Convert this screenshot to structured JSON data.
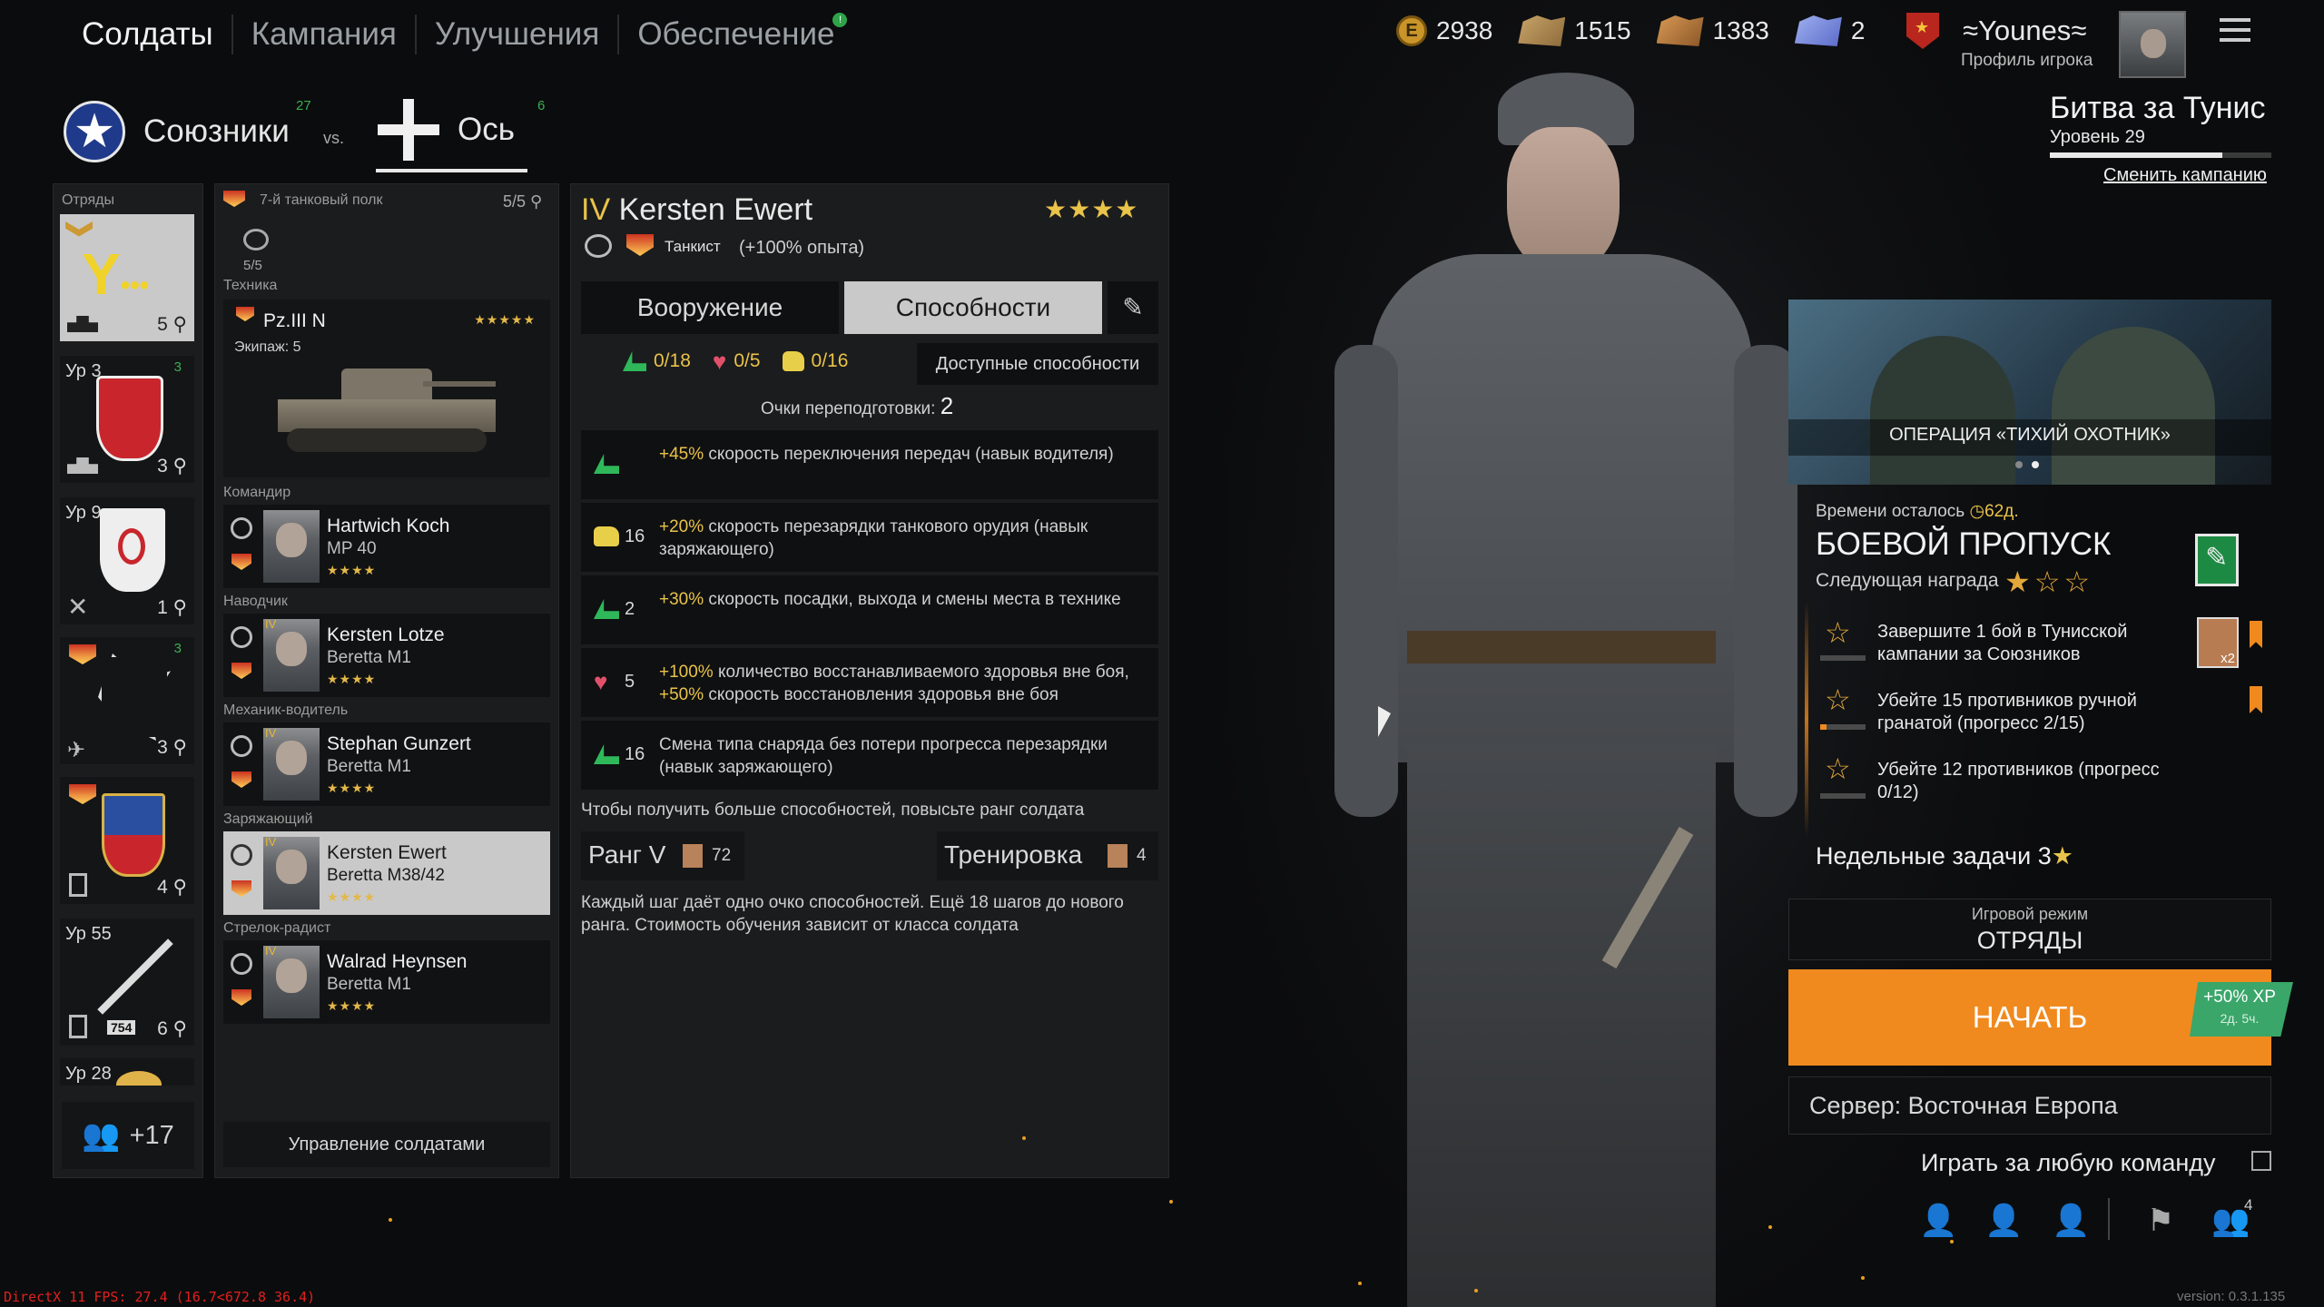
{
  "nav": {
    "tabs": [
      "Солдаты",
      "Кампания",
      "Улучшения",
      "Обеспечение"
    ],
    "supply_badge": "!"
  },
  "currency": {
    "gold": "2938",
    "orders_silver": "1515",
    "orders_bronze": "1383",
    "tickets": "2"
  },
  "profile": {
    "name": "Younes",
    "profile_label": "Профиль игрока"
  },
  "campaign": {
    "title": "Битва за Тунис",
    "level": "Уровень 29",
    "progress": 0.78,
    "change_link": "Сменить кампанию"
  },
  "factions": {
    "allies": "Союзники",
    "allies_count": "27",
    "vs": "vs.",
    "axis": "Ось",
    "axis_count": "6"
  },
  "squads": {
    "header": "Отряды",
    "items": [
      {
        "level": "",
        "count": "5"
      },
      {
        "level": "Ур 3",
        "count": "3",
        "badge": "3"
      },
      {
        "level": "Ур 9",
        "count": "1"
      },
      {
        "level": "",
        "count": "3",
        "badge": "3"
      },
      {
        "level": "",
        "count": "4"
      },
      {
        "level": "Ур 55",
        "count": "6",
        "tag": "754"
      },
      {
        "level": "Ур 28",
        "count": ""
      }
    ],
    "more": "+17"
  },
  "squad_detail": {
    "name": "7-й танковый полк",
    "capacity": "5/5",
    "vehicle_count": "5/5",
    "vehicle_section": "Техника",
    "vehicle_name": "Pz.III N",
    "vehicle_crew": "Экипаж: 5",
    "vehicle_stars": "★★★★★",
    "manage_button": "Управление солдатами",
    "soldiers": [
      {
        "role": "Командир",
        "name": "Hartwich Koch",
        "weapon": "MP 40",
        "stars": "★★★★",
        "rank": ""
      },
      {
        "role": "Наводчик",
        "name": "Kersten Lotze",
        "weapon": "Beretta M1",
        "stars": "★★★★",
        "rank": "IV"
      },
      {
        "role": "Механик-водитель",
        "name": "Stephan Gunzert",
        "weapon": "Beretta M1",
        "stars": "★★★★",
        "rank": "IV"
      },
      {
        "role": "Заряжающий",
        "name": "Kersten Ewert",
        "weapon": "Beretta M38/42",
        "stars": "★★★★",
        "rank": "IV"
      },
      {
        "role": "Стрелок-радист",
        "name": "Walrad Heynsen",
        "weapon": "Beretta M1",
        "stars": "★★★★",
        "rank": "IV"
      }
    ]
  },
  "soldier": {
    "rank": "IV",
    "name": "Kersten Ewert",
    "stars": "★★★★",
    "class": "Танкист",
    "bonus": "(+100% опыта)",
    "tab_weapons": "Вооружение",
    "tab_abilities": "Способности",
    "stat_a": "0/18",
    "stat_b": "0/5",
    "stat_c": "0/16",
    "available_button": "Доступные способности",
    "retrain_label": "Очки переподготовки:",
    "retrain_value": "2",
    "abilities": [
      {
        "num": "",
        "hl": "+45%",
        "text": " скорость переключения передач (навык водителя)",
        "hl2": "",
        "text2": ""
      },
      {
        "num": "16",
        "hl": "+20%",
        "text": " скорость перезарядки танкового орудия (навык заряжающего)",
        "hl2": "",
        "text2": ""
      },
      {
        "num": "2",
        "hl": "+30%",
        "text": " скорость посадки, выхода и смены места в технике",
        "hl2": "",
        "text2": ""
      },
      {
        "num": "5",
        "hl": "+100%",
        "text": " количество восстанавливаемого здоровья вне боя, ",
        "hl2": "+50%",
        "text2": " скорость восстановления здоровья вне боя"
      },
      {
        "num": "16",
        "hl": "",
        "text": "Смена типа снаряда без потери прогресса перезарядки (навык заряжающего)",
        "hl2": "",
        "text2": ""
      }
    ],
    "more_abilities_hint": "Чтобы получить больше способностей, повысьте ранг солдата",
    "rank_button": "Ранг V",
    "rank_cost": "72",
    "training_button": "Тренировка",
    "training_cost": "4",
    "footer_text": "Каждый шаг даёт одно очко способностей. Ещё 18 шагов до нового ранга. Стоимость обучения зависит от класса солдата"
  },
  "event": {
    "banner_title": "ОПЕРАЦИЯ «ТИХИЙ ОХОТНИК»",
    "time_left_label": "Времени осталось",
    "time_left_value": "62д."
  },
  "battle_pass": {
    "title": "БОЕВОЙ ПРОПУСК",
    "next_reward": "Следующая награда",
    "tasks": [
      {
        "text": "Завершите 1 бой в Тунисской кампании за Союзников",
        "progress": 0.0
      },
      {
        "text": "Убейте 15 противников ручной гранатой (прогресс 2/15)",
        "progress": 0.13
      },
      {
        "text": "Убейте 12 противников (прогресс 0/12)",
        "progress": 0.0
      }
    ],
    "reward_mult": "x2",
    "weekly_label": "Недельные задачи",
    "weekly_count": "3"
  },
  "play": {
    "mode_label": "Игровой режим",
    "mode_value": "ОТРЯДЫ",
    "start_button": "НАЧАТЬ",
    "xp_bonus": "+50% XP",
    "xp_time": "2д. 5ч.",
    "server": "Сервер: Восточная Европа",
    "any_team": "Играть за любую команду",
    "squad_count": "4"
  },
  "debug": {
    "fps": "DirectX 11 FPS: 27.4 (16.7<672.8 36.4)",
    "version": "version: 0.3.1.135"
  },
  "colors": {
    "accent_orange": "#f08a1e",
    "highlight_yellow": "#e9c34a",
    "green": "#2fb85a"
  }
}
